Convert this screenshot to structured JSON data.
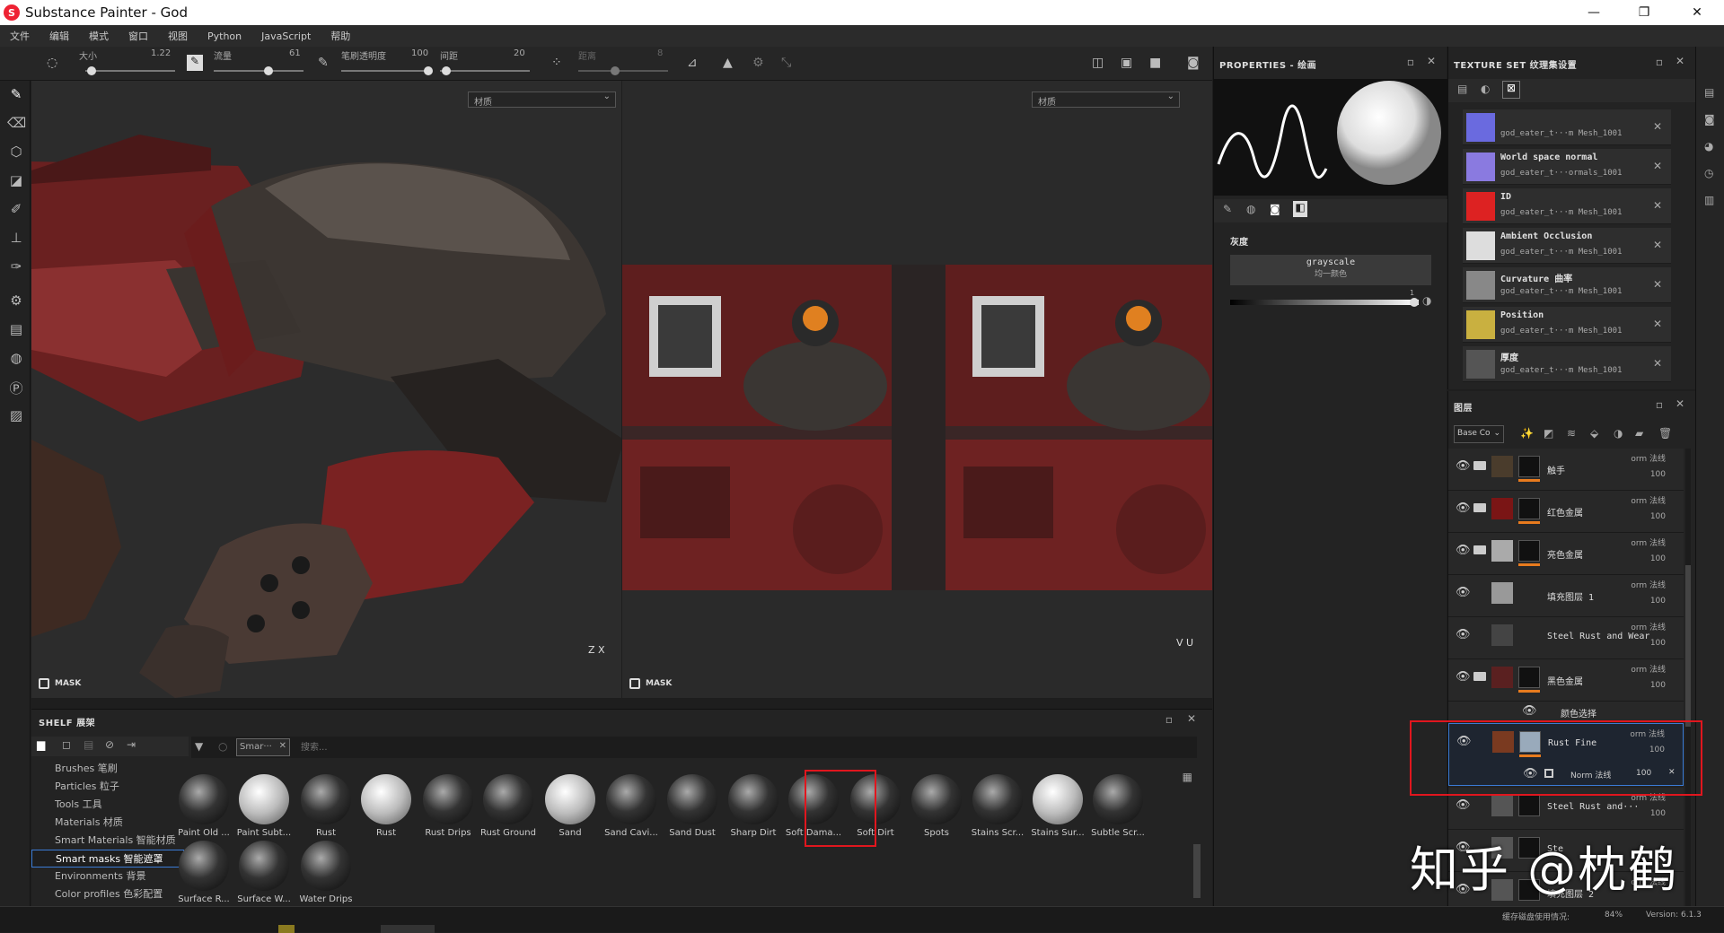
{
  "window": {
    "title": "Substance Painter - God",
    "controls": [
      "—",
      "❐",
      "✕"
    ]
  },
  "menu": [
    "文件",
    "编辑",
    "模式",
    "窗口",
    "视图",
    "Python",
    "JavaScript",
    "帮助"
  ],
  "toolbar": {
    "size_label": "大小",
    "size_value": "1.22",
    "flow_label": "流量",
    "flow_value": "61",
    "opacity_label": "笔刷透明度",
    "opacity_value": "100",
    "spacing_label": "间距",
    "spacing_value": "20",
    "distance_label": "距离",
    "distance_value": "8"
  },
  "viewport3d": {
    "dropdown": "材质",
    "mask": "MASK",
    "axes": "Z X"
  },
  "viewport2d": {
    "dropdown": "材质",
    "mask": "MASK",
    "axes": "V U"
  },
  "shelf": {
    "title": "SHELF 展架",
    "filter_tag": "Smar···",
    "search_placeholder": "搜索...",
    "categories": [
      "Brushes 笔刷",
      "Particles 粒子",
      "Tools 工具",
      "Materials 材质",
      "Smart Materials 智能材质",
      "Smart masks 智能遮罩",
      "Environments 背景",
      "Color profiles 色彩配置"
    ],
    "selected_category": "Smart masks 智能遮罩",
    "items": [
      "Paint Old ...",
      "Paint Subt...",
      "Rust",
      "Rust",
      "Rust Drips",
      "Rust Ground",
      "Sand",
      "Sand Cavi...",
      "Sand Dust",
      "Sharp Dirt",
      "Soft Dama...",
      "Soft Dirt",
      "Spots",
      "Stains Scr...",
      "Stains Sur...",
      "Subtle Scr...",
      "Surface R...",
      "Surface W...",
      "Water Drips"
    ],
    "selected_item": "Soft Dama..."
  },
  "properties": {
    "title": "PROPERTIES - 绘画",
    "section": "灰度",
    "grayscale_title": "grayscale",
    "grayscale_sub": "均一颜色",
    "value": "1"
  },
  "texture_set": {
    "title": "TEXTURE SET 纹理集设置",
    "channels": [
      {
        "name": "",
        "mesh": "god_eater_t···m Mesh_1001",
        "color": "#6a6adf"
      },
      {
        "name": "World space normal",
        "mesh": "god_eater_t···ormals_1001",
        "color": "#8a7ae0"
      },
      {
        "name": "ID",
        "mesh": "god_eater_t···m Mesh_1001",
        "color": "#d22"
      },
      {
        "name": "Ambient Occlusion",
        "mesh": "god_eater_t···m Mesh_1001",
        "color": "#ddd"
      },
      {
        "name": "Curvature 曲率",
        "mesh": "god_eater_t···m Mesh_1001",
        "color": "#888"
      },
      {
        "name": "Position",
        "mesh": "god_eater_t···m Mesh_1001",
        "color": "#c9b040"
      },
      {
        "name": "厚度",
        "mesh": "god_eater_t···m Mesh_1001",
        "color": "#555"
      }
    ]
  },
  "layers": {
    "title": "图层",
    "channel_select": "Base Co",
    "items": [
      {
        "name": "触手",
        "blend": "orm 法线",
        "opacity": "100",
        "swatch": "#4a3c2c",
        "folder": true
      },
      {
        "name": "红色金属",
        "blend": "orm 法线",
        "opacity": "100",
        "swatch": "#7a1515",
        "folder": true
      },
      {
        "name": "亮色金属",
        "blend": "orm 法线",
        "opacity": "100",
        "swatch": "#aaaaaa",
        "folder": true
      },
      {
        "name": "填充图层 1",
        "blend": "orm 法线",
        "opacity": "100",
        "swatch": "#999999",
        "folder": false
      },
      {
        "name": "Steel Rust and Wear",
        "blend": "orm 法线",
        "opacity": "100",
        "swatch": "#444444",
        "folder": false
      },
      {
        "name": "黑色金属",
        "blend": "orm 法线",
        "opacity": "100",
        "swatch": "#5a2020",
        "folder": true
      }
    ],
    "color_select": "颜色选择",
    "selected": {
      "name": "Rust Fine",
      "blend": "orm 法线",
      "opacity": "100",
      "sub_blend": "Norm 法线",
      "sub_opacity": "100"
    },
    "after": [
      {
        "name": "Steel Rust and···",
        "blend": "orm 法线",
        "opacity": "100"
      },
      {
        "name": "Ste",
        "blend": "",
        "opacity": ""
      },
      {
        "name": "填充图层 2",
        "blend": "orm 法线",
        "opacity": ""
      }
    ]
  },
  "status": {
    "cache": "缓存磁盘使用情况:",
    "percent": "84%",
    "version": "Version: 6.1.3"
  },
  "watermark": "知乎 @枕鹤"
}
